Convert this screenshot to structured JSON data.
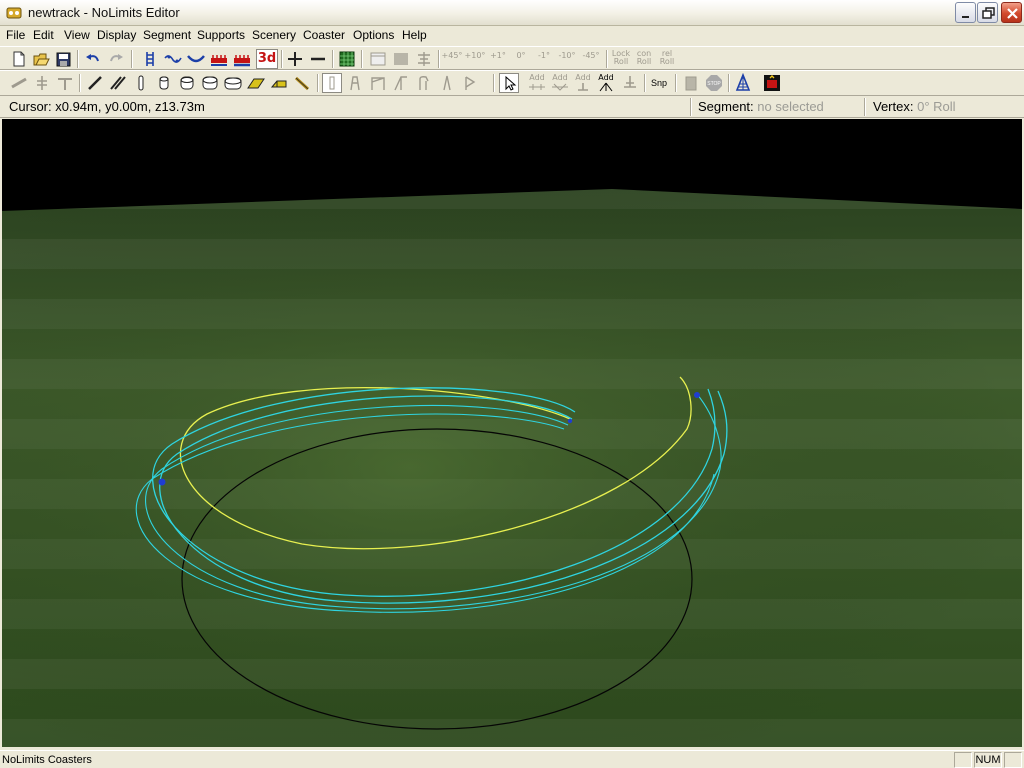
{
  "window": {
    "title": "newtrack - NoLimits Editor",
    "icon": "nolimits-app-icon"
  },
  "menu": [
    "File",
    "Edit",
    "View",
    "Display",
    "Segment",
    "Supports",
    "Scenery",
    "Coaster",
    "Options",
    "Help"
  ],
  "toolbar1": {
    "roll_buttons": [
      "+45°",
      "+10°",
      "+1°",
      "0°",
      "-1°",
      "-10°",
      "-45°"
    ],
    "lock_roll": [
      "Lock",
      "Roll"
    ],
    "con_roll": [
      "con",
      "Roll"
    ],
    "rel_roll": [
      "rel",
      "Roll"
    ],
    "view_3d": "3d"
  },
  "toolbar2": {
    "add_buttons": [
      {
        "label": "Add",
        "enabled": false
      },
      {
        "label": "Add",
        "enabled": false
      },
      {
        "label": "Add",
        "enabled": false
      },
      {
        "label": "Add",
        "enabled": true
      }
    ],
    "snap": "Snp",
    "stop": "STOP"
  },
  "info": {
    "cursor": "Cursor: x0.94m, y0.00m, z13.73m",
    "segment_label": "Segment:",
    "segment_value": "no selected",
    "vertex_label": "Vertex:",
    "vertex_value": "0° Roll"
  },
  "status": {
    "text": "NoLimits Coasters",
    "num": "NUM"
  },
  "colors": {
    "track": "#2fd4e0",
    "spine": "#e8f050",
    "ground_light": "#4c6e33",
    "ground_dark": "#2b4220",
    "sky": "#000000",
    "vertex": "#1f3dd1"
  }
}
